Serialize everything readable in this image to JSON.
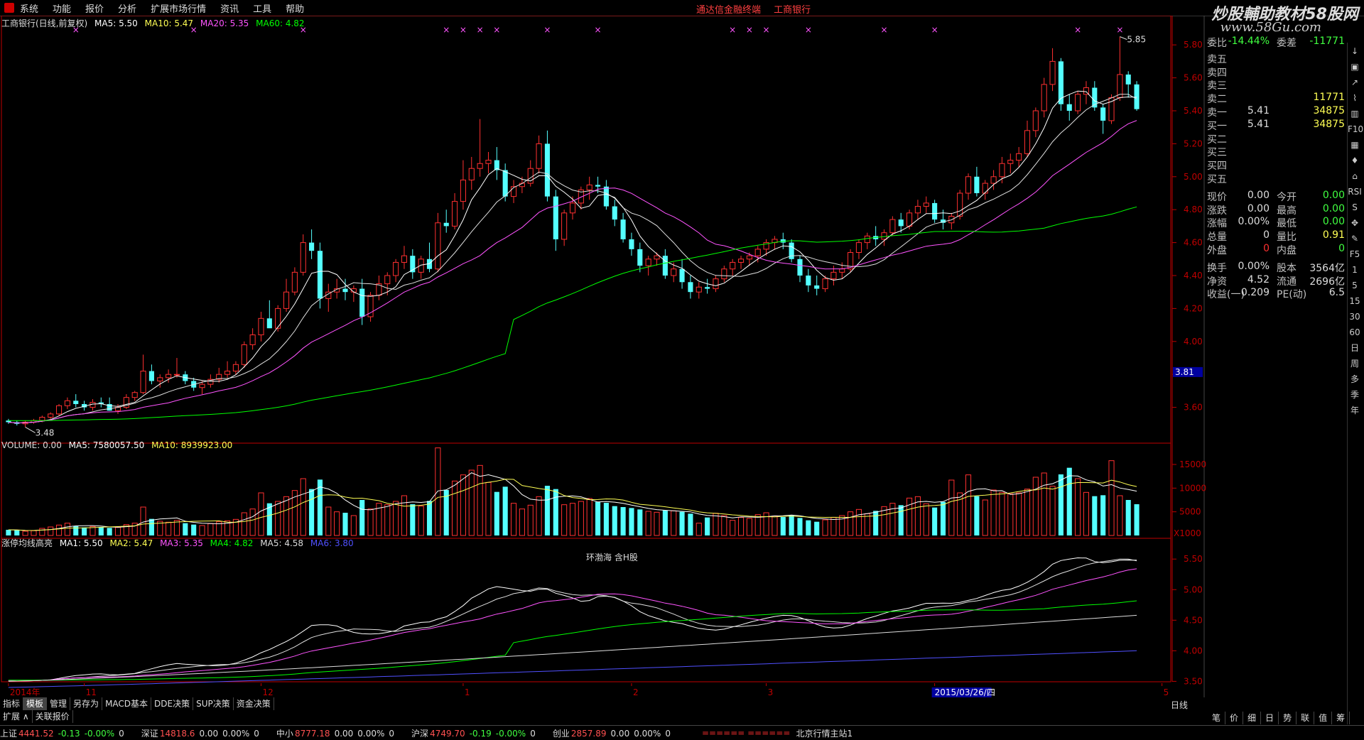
{
  "menu": [
    "系统",
    "功能",
    "报价",
    "分析",
    "扩展市场行情",
    "资讯",
    "工具",
    "帮助"
  ],
  "menu_center": [
    "通达信金融终端",
    "工商银行"
  ],
  "brand": "炒股輔助教材58股网",
  "brand_url": "www.58Gu.com",
  "main_title": {
    "stock": "工商银行(日线,前复权)",
    "ma5": "MA5: 5.50",
    "ma10": "MA10: 5.47",
    "ma20": "MA20: 5.35",
    "ma60": "MA60: 4.82"
  },
  "volume_title": {
    "vol": "VOLUME: 0.00",
    "ma5": "MA5: 7580057.50",
    "ma10": "MA10: 8939923.00"
  },
  "ind_title": {
    "name": "涨停均线高亮",
    "ma1": "MA1: 5.50",
    "ma2": "MA2: 5.47",
    "ma3": "MA3: 5.35",
    "ma4": "MA4: 4.82",
    "ma5": "MA5: 4.58",
    "ma6": "MA6: 3.80"
  },
  "annotation": "环渤海 含H股",
  "price_high_label": "5.85",
  "price_low_label": "3.48",
  "price_marker": "3.81",
  "vol_unit": "X1000",
  "colors": {
    "up": "#ff3030",
    "down": "#54ffff",
    "ma5": "#ffffff",
    "ma10": "#ffff54",
    "ma20": "#ff54ff",
    "ma60": "#00ff00",
    "ma6": "#5050ff",
    "axis": "#c00000"
  },
  "price_axis": [
    "5.80",
    "5.60",
    "5.40",
    "5.20",
    "5.00",
    "4.80",
    "4.60",
    "4.40",
    "4.20",
    "4.00",
    "3.80",
    "3.60"
  ],
  "vol_axis": [
    "15000",
    "10000",
    "5000"
  ],
  "ind_axis": [
    "5.50",
    "5.00",
    "4.50",
    "4.00",
    "3.50"
  ],
  "date_labels": [
    {
      "t": "2014年",
      "k": 0
    },
    {
      "t": "11",
      "k": 9
    },
    {
      "t": "12",
      "k": 30
    },
    {
      "t": "1",
      "k": 54
    },
    {
      "t": "2",
      "k": 74
    },
    {
      "t": "3",
      "k": 90
    },
    {
      "t": "2015/03/26/四",
      "k": 110
    },
    {
      "t": "5",
      "k": 137
    }
  ],
  "quote": [
    {
      "l": "委比",
      "v": "-14.44%",
      "l2": "委差",
      "v2": "-11771",
      "c": "#40ff40"
    },
    {
      "l": "卖五",
      "v": "",
      "l2": "",
      "v2": ""
    },
    {
      "l": "卖四",
      "v": "",
      "l2": "",
      "v2": ""
    },
    {
      "l": "卖三",
      "v": "",
      "l2": "",
      "v2": ""
    },
    {
      "l": "卖二",
      "v": "",
      "l2": "",
      "v2": "11771",
      "c2": "#ffff54"
    },
    {
      "l": "卖一",
      "v": "5.41",
      "l2": "",
      "v2": "34875",
      "c2": "#ffff54"
    },
    {
      "l": "买一",
      "v": "5.41",
      "l2": "",
      "v2": "34875",
      "c2": "#ffff54"
    },
    {
      "l": "买二",
      "v": "",
      "l2": "",
      "v2": ""
    },
    {
      "l": "买三",
      "v": "",
      "l2": "",
      "v2": ""
    },
    {
      "l": "买四",
      "v": "",
      "l2": "",
      "v2": ""
    },
    {
      "l": "买五",
      "v": "",
      "l2": "",
      "v2": ""
    },
    {
      "l": "现价",
      "v": "0.00",
      "l2": "今开",
      "v2": "0.00",
      "c2": "#40ff40"
    },
    {
      "l": "涨跌",
      "v": "0.00",
      "l2": "最高",
      "v2": "0.00",
      "c2": "#40ff40"
    },
    {
      "l": "涨幅",
      "v": "0.00%",
      "l2": "最低",
      "v2": "0.00",
      "c2": "#40ff40"
    },
    {
      "l": "总量",
      "v": "0",
      "l2": "量比",
      "v2": "0.91",
      "c2": "#ffff54"
    },
    {
      "l": "外盘",
      "v": "0",
      "c": "#ff3030",
      "l2": "内盘",
      "v2": "0",
      "c2": "#40ff40"
    },
    {
      "l": "换手",
      "v": "0.00%",
      "l2": "股本",
      "v2": "3564亿"
    },
    {
      "l": "净资",
      "v": "4.52",
      "l2": "流通",
      "v2": "2696亿"
    },
    {
      "l": "收益(一)",
      "v": "0.209",
      "l2": "PE(动)",
      "v2": "6.5"
    }
  ],
  "bottom_tabs": [
    "指标",
    "模板",
    "管理",
    "另存为",
    "MACD基本",
    "DDE决策",
    "SUP决策",
    "资金决策"
  ],
  "sub_tabs": [
    "扩展 ∧",
    "关联报价"
  ],
  "right_tabs": [
    "笔",
    "价",
    "细",
    "日",
    "势",
    "联",
    "值",
    "筹"
  ],
  "daily_label": "日线",
  "side_tools": [
    "↓",
    "▣",
    "↗",
    "⌇",
    "▥",
    "F10",
    "▦",
    "♦",
    "⌂",
    "RSI",
    "S",
    "✥",
    "✎",
    "F5",
    "1",
    "5",
    "15",
    "30",
    "60",
    "日",
    "周",
    "多",
    "季",
    "年"
  ],
  "status": [
    {
      "name": "上证",
      "val": "4441.52",
      "chg": "-0.13",
      "pct": "-0.00%",
      "vol": "0"
    },
    {
      "name": "深证",
      "val": "14818.6",
      "chg": "0.00",
      "pct": "0.00%",
      "vol": "0"
    },
    {
      "name": "中小",
      "val": "8777.18",
      "chg": "0.00",
      "pct": "0.00%",
      "vol": "0"
    },
    {
      "name": "沪深",
      "val": "4749.70",
      "chg": "-0.19",
      "pct": "-0.00%",
      "vol": "0"
    },
    {
      "name": "创业",
      "val": "2857.89",
      "chg": "0.00",
      "pct": "0.00%",
      "vol": "0"
    }
  ],
  "status_tail": "北京行情主站1",
  "chart_data": {
    "type": "candlestick",
    "title": "工商银行(日线,前复权)",
    "ylim": [
      3.4,
      5.9
    ],
    "candles": [
      [
        3.52,
        3.53,
        3.5,
        3.51
      ],
      [
        3.51,
        3.52,
        3.49,
        3.5
      ],
      [
        3.5,
        3.52,
        3.48,
        3.51
      ],
      [
        3.51,
        3.53,
        3.5,
        3.52
      ],
      [
        3.52,
        3.55,
        3.51,
        3.54
      ],
      [
        3.54,
        3.57,
        3.53,
        3.56
      ],
      [
        3.56,
        3.62,
        3.55,
        3.61
      ],
      [
        3.61,
        3.66,
        3.59,
        3.64
      ],
      [
        3.64,
        3.68,
        3.6,
        3.62
      ],
      [
        3.62,
        3.64,
        3.58,
        3.6
      ],
      [
        3.6,
        3.65,
        3.58,
        3.63
      ],
      [
        3.63,
        3.66,
        3.6,
        3.62
      ],
      [
        3.62,
        3.66,
        3.58,
        3.58
      ],
      [
        3.58,
        3.62,
        3.56,
        3.6
      ],
      [
        3.6,
        3.68,
        3.59,
        3.66
      ],
      [
        3.66,
        3.7,
        3.64,
        3.69
      ],
      [
        3.69,
        3.92,
        3.68,
        3.82
      ],
      [
        3.82,
        3.86,
        3.74,
        3.76
      ],
      [
        3.76,
        3.8,
        3.72,
        3.78
      ],
      [
        3.78,
        3.83,
        3.75,
        3.8
      ],
      [
        3.8,
        3.9,
        3.78,
        3.8
      ],
      [
        3.8,
        3.82,
        3.74,
        3.76
      ],
      [
        3.76,
        3.78,
        3.7,
        3.72
      ],
      [
        3.72,
        3.76,
        3.68,
        3.74
      ],
      [
        3.74,
        3.8,
        3.72,
        3.77
      ],
      [
        3.77,
        3.84,
        3.75,
        3.8
      ],
      [
        3.8,
        3.88,
        3.78,
        3.82
      ],
      [
        3.82,
        3.88,
        3.8,
        3.86
      ],
      [
        3.86,
        4.0,
        3.84,
        3.98
      ],
      [
        3.98,
        4.08,
        3.95,
        4.04
      ],
      [
        4.04,
        4.18,
        4.0,
        4.14
      ],
      [
        4.14,
        4.25,
        4.1,
        4.08
      ],
      [
        4.08,
        4.22,
        4.06,
        4.2
      ],
      [
        4.2,
        4.38,
        4.18,
        4.3
      ],
      [
        4.3,
        4.45,
        4.28,
        4.42
      ],
      [
        4.42,
        4.65,
        4.4,
        4.6
      ],
      [
        4.6,
        4.68,
        4.5,
        4.55
      ],
      [
        4.55,
        4.6,
        4.2,
        4.26
      ],
      [
        4.26,
        4.35,
        4.18,
        4.3
      ],
      [
        4.3,
        4.38,
        4.26,
        4.32
      ],
      [
        4.32,
        4.38,
        4.25,
        4.3
      ],
      [
        4.3,
        4.34,
        4.24,
        4.32
      ],
      [
        4.32,
        4.38,
        4.1,
        4.15
      ],
      [
        4.15,
        4.3,
        4.12,
        4.28
      ],
      [
        4.28,
        4.4,
        4.25,
        4.35
      ],
      [
        4.35,
        4.42,
        4.28,
        4.4
      ],
      [
        4.4,
        4.5,
        4.36,
        4.48
      ],
      [
        4.48,
        4.58,
        4.44,
        4.52
      ],
      [
        4.52,
        4.56,
        4.38,
        4.42
      ],
      [
        4.42,
        4.52,
        4.38,
        4.5
      ],
      [
        4.5,
        4.6,
        4.42,
        4.44
      ],
      [
        4.44,
        4.78,
        4.42,
        4.72
      ],
      [
        4.72,
        4.8,
        4.66,
        4.7
      ],
      [
        4.7,
        4.9,
        4.68,
        4.85
      ],
      [
        4.85,
        5.1,
        4.8,
        4.98
      ],
      [
        4.98,
        5.12,
        4.92,
        5.05
      ],
      [
        5.05,
        5.35,
        5.0,
        5.08
      ],
      [
        5.08,
        5.15,
        5.02,
        5.1
      ],
      [
        5.1,
        5.18,
        4.98,
        5.04
      ],
      [
        5.04,
        5.08,
        4.85,
        4.88
      ],
      [
        4.88,
        4.98,
        4.84,
        4.94
      ],
      [
        4.94,
        5.0,
        4.9,
        4.96
      ],
      [
        4.96,
        5.1,
        4.94,
        5.05
      ],
      [
        5.05,
        5.25,
        5.02,
        5.2
      ],
      [
        5.2,
        5.28,
        4.85,
        4.88
      ],
      [
        4.88,
        4.92,
        4.55,
        4.62
      ],
      [
        4.62,
        4.8,
        4.58,
        4.78
      ],
      [
        4.78,
        4.88,
        4.74,
        4.84
      ],
      [
        4.84,
        4.94,
        4.8,
        4.92
      ],
      [
        4.92,
        5.0,
        4.86,
        4.95
      ],
      [
        4.95,
        5.0,
        4.9,
        4.94
      ],
      [
        4.94,
        4.98,
        4.8,
        4.82
      ],
      [
        4.82,
        4.86,
        4.7,
        4.74
      ],
      [
        4.74,
        4.78,
        4.6,
        4.62
      ],
      [
        4.62,
        4.66,
        4.52,
        4.56
      ],
      [
        4.56,
        4.6,
        4.42,
        4.46
      ],
      [
        4.46,
        4.52,
        4.4,
        4.5
      ],
      [
        4.5,
        4.54,
        4.46,
        4.52
      ],
      [
        4.52,
        4.56,
        4.38,
        4.4
      ],
      [
        4.4,
        4.48,
        4.36,
        4.44
      ],
      [
        4.44,
        4.5,
        4.32,
        4.36
      ],
      [
        4.36,
        4.4,
        4.26,
        4.3
      ],
      [
        4.3,
        4.36,
        4.26,
        4.33
      ],
      [
        4.33,
        4.38,
        4.29,
        4.32
      ],
      [
        4.32,
        4.4,
        4.3,
        4.38
      ],
      [
        4.38,
        4.46,
        4.36,
        4.44
      ],
      [
        4.44,
        4.5,
        4.4,
        4.48
      ],
      [
        4.48,
        4.52,
        4.44,
        4.5
      ],
      [
        4.5,
        4.54,
        4.46,
        4.52
      ],
      [
        4.52,
        4.58,
        4.48,
        4.56
      ],
      [
        4.56,
        4.62,
        4.52,
        4.6
      ],
      [
        4.6,
        4.64,
        4.56,
        4.62
      ],
      [
        4.62,
        4.66,
        4.56,
        4.6
      ],
      [
        4.6,
        4.62,
        4.48,
        4.5
      ],
      [
        4.5,
        4.52,
        4.36,
        4.4
      ],
      [
        4.4,
        4.44,
        4.3,
        4.34
      ],
      [
        4.34,
        4.4,
        4.28,
        4.32
      ],
      [
        4.32,
        4.4,
        4.3,
        4.38
      ],
      [
        4.38,
        4.46,
        4.34,
        4.42
      ],
      [
        4.42,
        4.48,
        4.38,
        4.44
      ],
      [
        4.44,
        4.56,
        4.42,
        4.54
      ],
      [
        4.54,
        4.62,
        4.5,
        4.6
      ],
      [
        4.6,
        4.66,
        4.56,
        4.64
      ],
      [
        4.64,
        4.7,
        4.58,
        4.62
      ],
      [
        4.62,
        4.68,
        4.58,
        4.66
      ],
      [
        4.66,
        4.76,
        4.64,
        4.74
      ],
      [
        4.74,
        4.78,
        4.66,
        4.7
      ],
      [
        4.7,
        4.8,
        4.68,
        4.78
      ],
      [
        4.78,
        4.86,
        4.74,
        4.82
      ],
      [
        4.82,
        4.88,
        4.78,
        4.84
      ],
      [
        4.84,
        4.86,
        4.72,
        4.74
      ],
      [
        4.74,
        4.8,
        4.68,
        4.72
      ],
      [
        4.72,
        4.78,
        4.68,
        4.76
      ],
      [
        4.76,
        4.92,
        4.74,
        4.9
      ],
      [
        4.9,
        5.02,
        4.86,
        5.0
      ],
      [
        5.0,
        5.06,
        4.88,
        4.9
      ],
      [
        4.9,
        4.98,
        4.86,
        4.96
      ],
      [
        4.96,
        5.04,
        4.92,
        5.0
      ],
      [
        5.0,
        5.12,
        4.96,
        5.08
      ],
      [
        5.08,
        5.14,
        5.02,
        5.1
      ],
      [
        5.1,
        5.18,
        5.06,
        5.14
      ],
      [
        5.14,
        5.34,
        5.12,
        5.28
      ],
      [
        5.28,
        5.42,
        5.24,
        5.4
      ],
      [
        5.4,
        5.6,
        5.36,
        5.56
      ],
      [
        5.56,
        5.78,
        5.52,
        5.7
      ],
      [
        5.7,
        5.72,
        5.4,
        5.44
      ],
      [
        5.44,
        5.5,
        5.34,
        5.4
      ],
      [
        5.4,
        5.52,
        5.38,
        5.5
      ],
      [
        5.5,
        5.58,
        5.44,
        5.54
      ],
      [
        5.54,
        5.58,
        5.4,
        5.42
      ],
      [
        5.42,
        5.44,
        5.26,
        5.34
      ],
      [
        5.34,
        5.5,
        5.32,
        5.48
      ],
      [
        5.48,
        5.85,
        5.46,
        5.62
      ],
      [
        5.62,
        5.64,
        5.48,
        5.56
      ],
      [
        5.56,
        5.58,
        5.4,
        5.41
      ]
    ],
    "volume": [
      1200,
      1100,
      900,
      1000,
      1500,
      1800,
      2200,
      2600,
      2000,
      1700,
      1900,
      1800,
      1600,
      1700,
      2300,
      2600,
      6000,
      3500,
      3000,
      2800,
      3200,
      2600,
      2300,
      2100,
      2500,
      2900,
      3100,
      3400,
      4800,
      5600,
      9000,
      6800,
      7200,
      8200,
      9500,
      12000,
      9800,
      11800,
      6000,
      5000,
      4800,
      4200,
      7500,
      5600,
      6800,
      6500,
      7200,
      8400,
      6600,
      6200,
      7300,
      18500,
      9600,
      11500,
      12800,
      13800,
      14800,
      11200,
      9200,
      10300,
      6800,
      5600,
      6400,
      8200,
      10500,
      9800,
      6500,
      6800,
      7200,
      7800,
      7100,
      6900,
      6200,
      6000,
      5800,
      5500,
      5100,
      4900,
      5300,
      5200,
      5000,
      4600,
      2600,
      3800,
      4700,
      4200,
      3200,
      3800,
      3600,
      4400,
      4800,
      4100,
      3900,
      4300,
      3700,
      3200,
      2900,
      3300,
      3800,
      4200,
      5000,
      5500,
      4600,
      5200,
      6100,
      6800,
      6400,
      7900,
      8200,
      6700,
      5900,
      7100,
      11700,
      9000,
      12800,
      8300,
      7500,
      9600,
      9100,
      8800,
      9000,
      9800,
      12300,
      13200,
      10400,
      12900,
      14300,
      12000,
      9100,
      8300,
      8500,
      15800,
      8400,
      7500,
      6600
    ],
    "series": [
      {
        "name": "MA5",
        "values": [
          5.5
        ]
      },
      {
        "name": "MA10",
        "values": [
          5.47
        ]
      },
      {
        "name": "MA20",
        "values": [
          5.35
        ]
      },
      {
        "name": "MA60",
        "values": [
          4.82
        ]
      }
    ],
    "vol_ylim": [
      0,
      18000
    ],
    "ind_ylim": [
      3.4,
      5.7
    ]
  }
}
